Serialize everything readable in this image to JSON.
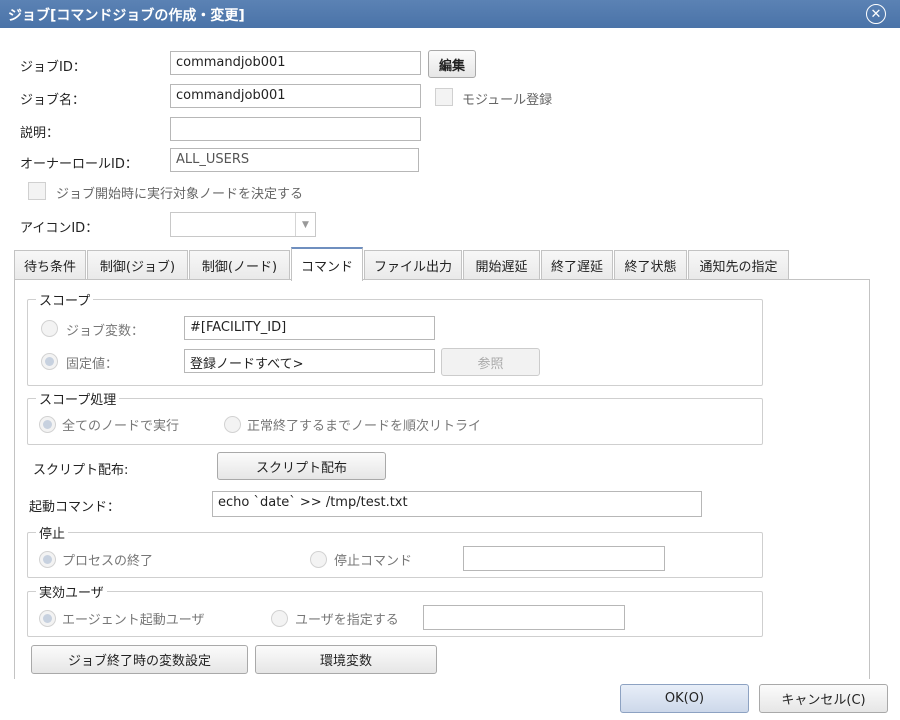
{
  "window": {
    "title": "ジョブ[コマンドジョブの作成・変更]",
    "close_icon": "close-icon"
  },
  "form": {
    "job_id_label": "ジョブID：",
    "job_id_value": "commandjob001",
    "edit_button": "編集",
    "job_name_label": "ジョブ名：",
    "job_name_value": "commandjob001",
    "module_register_label": "モジュール登録",
    "description_label": "説明：",
    "description_value": "",
    "owner_role_label": "オーナーロールID：",
    "owner_role_value": "ALL_USERS",
    "decide_node_label": "ジョブ開始時に実行対象ノードを決定する",
    "icon_id_label": "アイコンID：",
    "icon_id_value": ""
  },
  "tabs": [
    {
      "label": "待ち条件",
      "active": false
    },
    {
      "label": "制御(ジョブ)",
      "active": false
    },
    {
      "label": "制御(ノード)",
      "active": false
    },
    {
      "label": "コマンド",
      "active": true
    },
    {
      "label": "ファイル出力",
      "active": false
    },
    {
      "label": "開始遅延",
      "active": false
    },
    {
      "label": "終了遅延",
      "active": false
    },
    {
      "label": "終了状態",
      "active": false
    },
    {
      "label": "通知先の指定",
      "active": false
    }
  ],
  "command_tab": {
    "scope": {
      "title": "スコープ",
      "job_variable_label": "ジョブ変数：",
      "job_variable_value": "#[FACILITY_ID]",
      "fixed_value_label": "固定値：",
      "fixed_value_value": "登録ノードすべて>",
      "reference_button": "参照",
      "selected": "fixed_value"
    },
    "scope_processing": {
      "title": "スコープ処理",
      "option_all_nodes": "全てのノードで実行",
      "option_retry": "正常終了するまでノードを順次リトライ",
      "selected": "all_nodes"
    },
    "script_distribution_label": "スクリプト配布:",
    "script_distribution_button": "スクリプト配布",
    "start_command_label": "起動コマンド：",
    "start_command_value": "echo `date` >> /tmp/test.txt",
    "stop": {
      "title": "停止",
      "option_process_end": "プロセスの終了",
      "option_stop_command": "停止コマンド",
      "stop_command_value": "",
      "selected": "process_end"
    },
    "effective_user": {
      "title": "実効ユーザ",
      "option_agent_user": "エージェント起動ユーザ",
      "option_specify_user": "ユーザを指定する",
      "user_value": "",
      "selected": "agent_user"
    },
    "variable_setting_button": "ジョブ終了時の変数設定",
    "env_variable_button": "環境変数"
  },
  "footer": {
    "ok_button": "OK(O)",
    "cancel_button": "キャンセル(C)"
  },
  "colors": {
    "titlebar": "#4f78ad",
    "active_tab_accent": "#6f8fbf"
  }
}
